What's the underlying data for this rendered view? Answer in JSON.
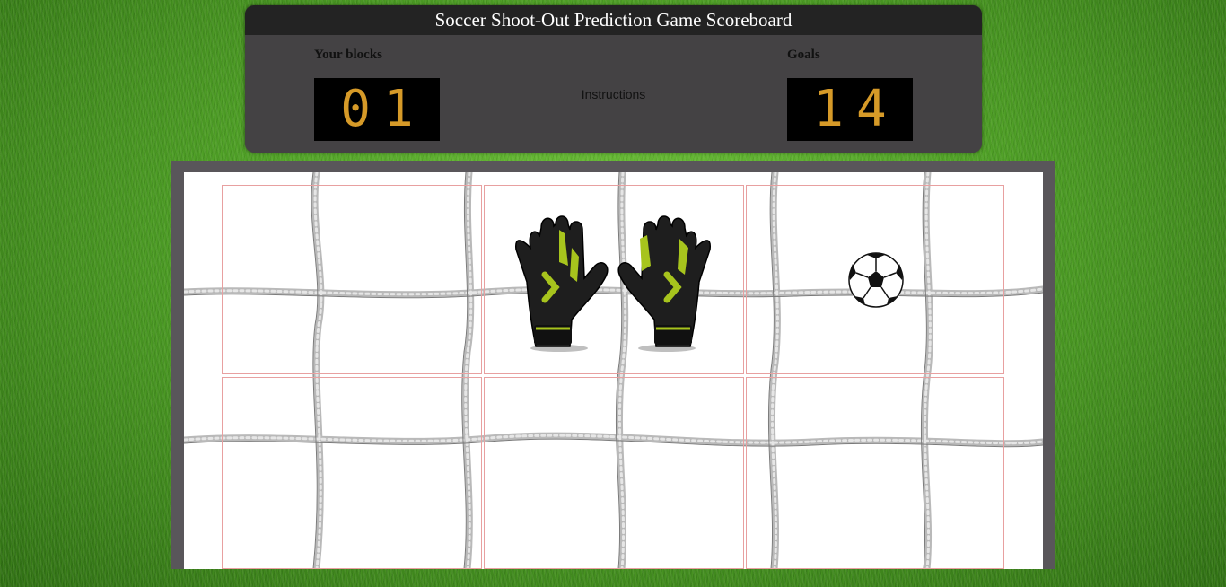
{
  "title": "Soccer Shoot-Out Prediction Game Scoreboard",
  "scoreboard": {
    "blocks_label": "Your blocks",
    "blocks_value": "01",
    "goals_label": "Goals",
    "goals_value": "14",
    "instructions": "Instructions"
  },
  "colors": {
    "digit": "#d69a28",
    "scoreboard_bg": "#444244",
    "title_bar": "#232323",
    "goal_frame": "#59565a",
    "zone_border": "#e8a0a0"
  },
  "goal": {
    "zones": [
      "top-left",
      "top-center",
      "top-right",
      "bottom-left",
      "bottom-center",
      "bottom-right"
    ],
    "glove_zone": "top-center",
    "ball_zone": "top-right",
    "icons": [
      "goalkeeper-gloves-icon",
      "soccer-ball-icon"
    ]
  }
}
